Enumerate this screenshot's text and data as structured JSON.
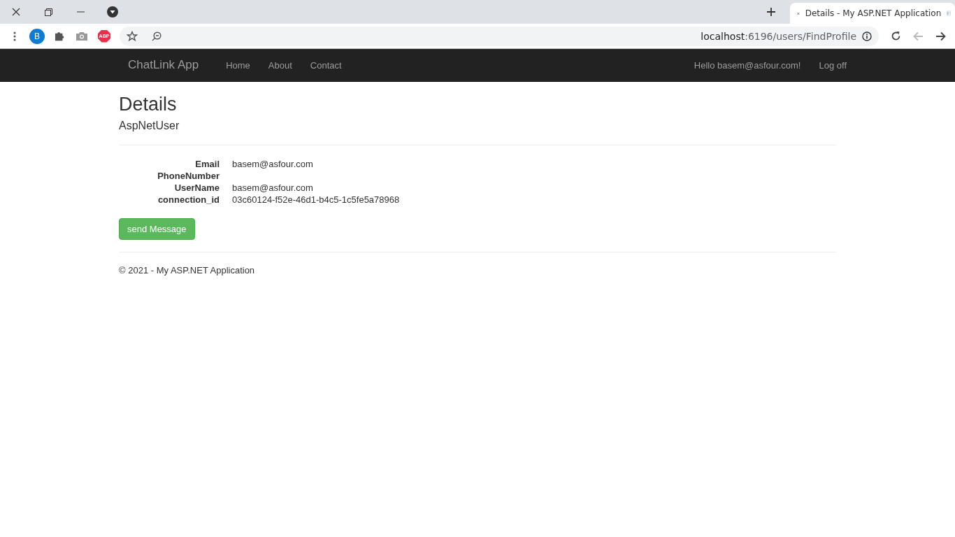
{
  "browser": {
    "tab": {
      "title": "Details - My ASP.NET Application",
      "selected": true
    },
    "profile_initial": "B",
    "adblock_label": "ABP",
    "address": {
      "host": "localhost",
      "path": ":6196/users/FindProfile"
    },
    "back_disabled": true
  },
  "navbar": {
    "brand": "ChatLink App",
    "links": [
      {
        "label": "Home"
      },
      {
        "label": "About"
      },
      {
        "label": "Contact"
      }
    ],
    "greeting": "Hello basem@asfour.com!",
    "logoff": "Log off"
  },
  "page": {
    "title": "Details",
    "subtitle": "AspNetUser",
    "fields": [
      {
        "label": "Email",
        "value": "basem@asfour.com"
      },
      {
        "label": "PhoneNumber"
      },
      {
        "label": "UserName",
        "value": "basem@asfour.com"
      },
      {
        "label": "connection_id",
        "value": "03c60124-f52e-46d1-b4c5-1c5fe5a78968"
      }
    ],
    "button": "send Message"
  },
  "footer": "© 2021 - My ASP.NET Application"
}
